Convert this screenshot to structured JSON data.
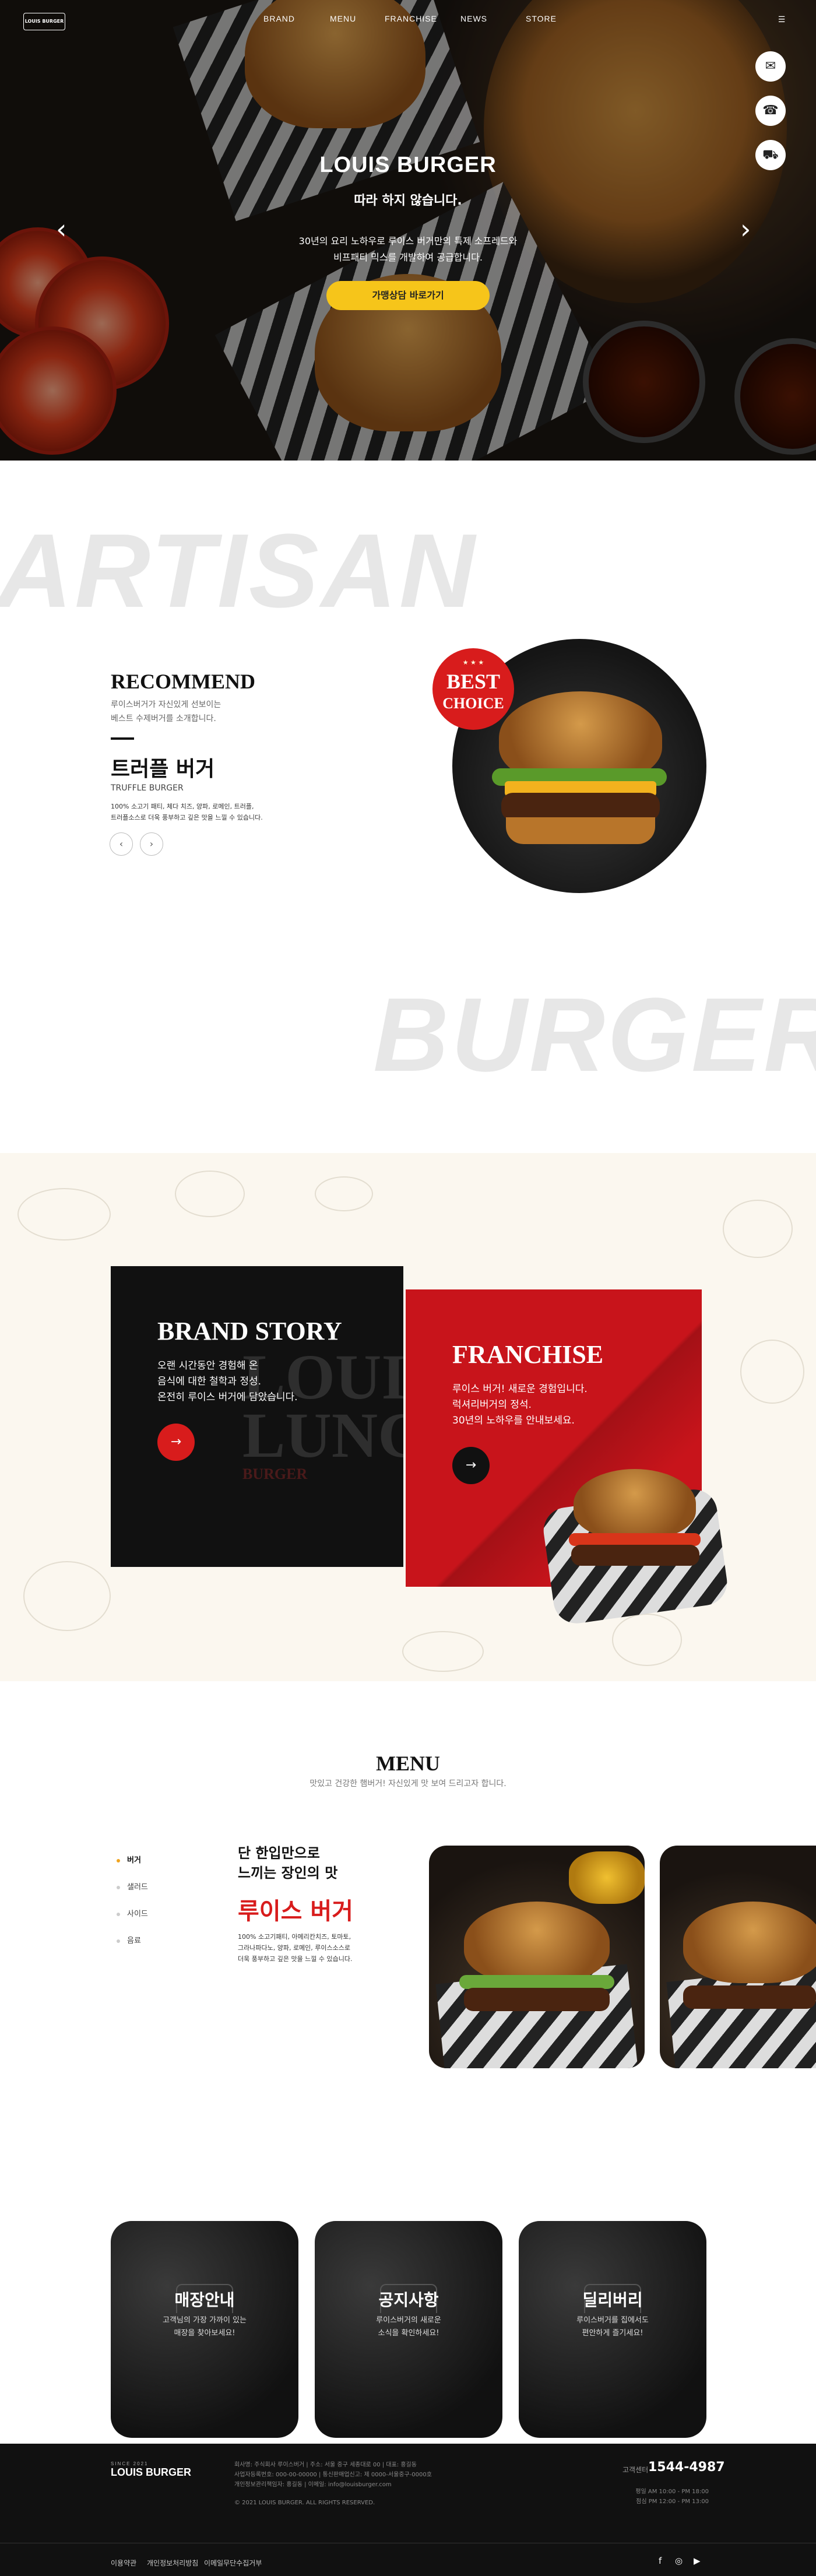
{
  "brand": {
    "logo_text": "LOUIS BURGER"
  },
  "nav": {
    "items": [
      "BRAND",
      "MENU",
      "FRANCHISE",
      "NEWS",
      "STORE"
    ]
  },
  "hero": {
    "title": "LOUIS BURGER",
    "subtitle": "따라 하지 않습니다.",
    "desc_line1": "30년의 요리 노하우로 루이스 버거만의 특제 소프레드와",
    "desc_line2": "비프패티 믹스를 개발하여 공급합니다.",
    "cta": "가맹상담 바로가기",
    "prev_icon": "chevron-left-icon",
    "next_icon": "chevron-right-icon"
  },
  "side_buttons": [
    {
      "icon": "chat-icon",
      "glyph": "✉"
    },
    {
      "icon": "headset-icon",
      "glyph": "☎"
    },
    {
      "icon": "delivery-scooter-icon",
      "glyph": "⛟"
    }
  ],
  "words": {
    "artisan": "ARTISAN",
    "burger": "BURGER"
  },
  "recommend": {
    "title": "RECOMMEND",
    "desc_line1": "루이스버거가 자신있게 선보이는",
    "desc_line2": "베스트 수제버거를 소개합니다.",
    "name": "트러플 버거",
    "name_en": "TRUFFLE BURGER",
    "ing_line1": "100% 소고기 패티, 체다 치즈, 양파, 로메인, 트러플,",
    "ing_line2": "트러플소스로 더욱 풍부하고 깊은 맛을 느낄 수 있습니다.",
    "prev": "‹",
    "next": "›",
    "badge_stars": "★ ★ ★",
    "badge_line1": "BEST",
    "badge_line2": "CHOICE"
  },
  "brand_story": {
    "title": "BRAND STORY",
    "line1": "오랜 시간동안 경험해 온",
    "line2": "음식에 대한 철학과 정성.",
    "line3": "온전히 루이스 버거에 담았습니다.",
    "watermark1": "LOUIS",
    "watermark2": "LUNCH",
    "watermark3": "BURGER",
    "arrow": "→"
  },
  "franchise": {
    "title": "FRANCHISE",
    "line1": "루이스 버거! 새로운 경험입니다.",
    "line2": "럭셔리버거의 정석.",
    "line3": "30년의 노하우를 안내보세요.",
    "arrow": "→"
  },
  "menu": {
    "title": "MENU",
    "subtitle": "맛있고 건강한 햄버거! 자신있게 맛 보여 드리고자 합니다.",
    "categories": [
      "버거",
      "샐러드",
      "사이드",
      "음료"
    ],
    "lead_line1": "단 한입만으로",
    "lead_line2": "느끼는 장인의 맛",
    "name": "루이스 버거",
    "desc_line1": "100% 소고기패티, 아메리칸치즈, 토마토,",
    "desc_line2": "그라나파다노, 양파, 로메인, 루이스소스로",
    "desc_line3": "더욱 풍부하고 깊은 맛을 느낄 수 있습니다."
  },
  "cards": [
    {
      "title": "매장안내",
      "line1": "고객님의 가장 가까이 있는",
      "line2": "매장을 찾아보세요!"
    },
    {
      "title": "공지사항",
      "line1": "루이스버거의 새로운",
      "line2": "소식을 확인하세요!"
    },
    {
      "title": "딜리버리",
      "line1": "루이스버거를 집에서도",
      "line2": "편안하게 즐기세요!"
    }
  ],
  "footer": {
    "logo_small": "SINCE 2021",
    "logo": "LOUIS BURGER",
    "info_line1": "회사명: 주식회사 루이스버거 | 주소: 서울 중구 세종대로 00 | 대표: 홍길동",
    "info_line2": "사업자등록번호: 000-00-00000 | 통신판매업신고: 제 0000-서울중구-0000호",
    "info_line3": "개인정보관리책임자: 홍길동 | 이메일: info@louisburger.com",
    "copyright": "© 2021 LOUIS BURGER. ALL RIGHTS RESERVED.",
    "tel_label": "고객센터",
    "tel": "1544-4987",
    "hours_line1": "평일 AM 10:00 - PM 18:00",
    "hours_line2": "점심 PM 12:00 - PM 13:00",
    "links": [
      "이용약관",
      "개인정보처리방침",
      "이메일무단수집거부"
    ],
    "social": [
      "f",
      "◎",
      "▶"
    ]
  }
}
